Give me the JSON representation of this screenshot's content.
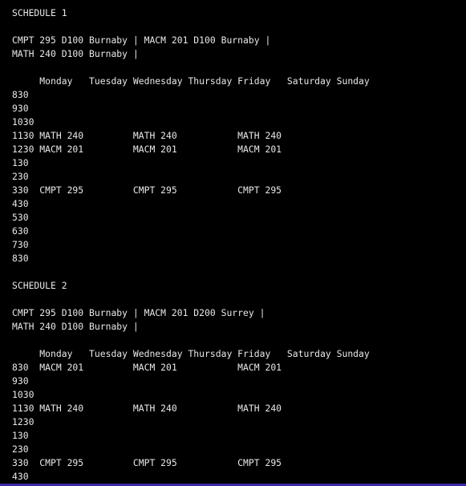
{
  "terminal": {
    "lines": [
      "SCHEDULE 1",
      "",
      "CMPT 295 D100 Burnaby | MACM 201 D100 Burnaby |",
      "MATH 240 D100 Burnaby |",
      "",
      "     Monday   Tuesday Wednesday Thursday Friday   Saturday Sunday",
      "830",
      "930",
      "1030",
      "1130 MATH 240         MATH 240           MATH 240",
      "1230 MACM 201         MACM 201           MACM 201",
      "130",
      "230",
      "330  CMPT 295         CMPT 295           CMPT 295",
      "430",
      "530",
      "630",
      "730",
      "830",
      "",
      "SCHEDULE 2",
      "",
      "CMPT 295 D100 Burnaby | MACM 201 D200 Surrey |",
      "MATH 240 D100 Burnaby |",
      "",
      "     Monday   Tuesday Wednesday Thursday Friday   Saturday Sunday",
      "830  MACM 201         MACM 201           MACM 201",
      "930",
      "1030",
      "1130 MATH 240         MATH 240           MATH 240",
      "1230",
      "130",
      "230",
      "330  CMPT 295         CMPT 295           CMPT 295",
      "430"
    ]
  },
  "colors": {
    "background": "#000000",
    "text": "#e8e8e8",
    "bottom_edge": "#3a2aa8"
  }
}
